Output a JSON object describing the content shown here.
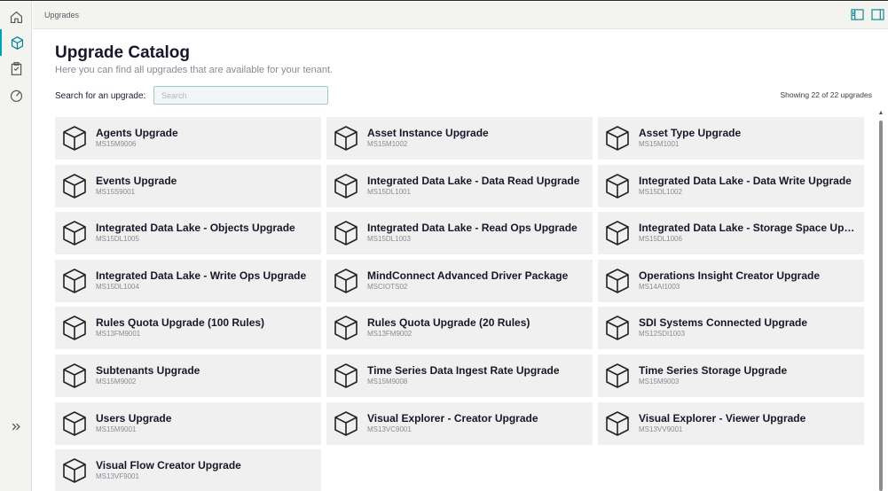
{
  "topbar": {
    "breadcrumb": "Upgrades"
  },
  "page": {
    "title": "Upgrade Catalog",
    "subtitle": "Here you can find all upgrades that are available for your tenant.",
    "search_label": "Search for an upgrade:",
    "search_placeholder": "Search",
    "search_value": "",
    "count_text": "Showing 22 of 22 upgrades"
  },
  "sidebar": {
    "items": [
      {
        "icon": "home-icon"
      },
      {
        "icon": "cube-icon",
        "active": true
      },
      {
        "icon": "clipboard-icon"
      },
      {
        "icon": "gauge-icon"
      }
    ],
    "expand_icon": "double-chevron-right-icon"
  },
  "upgrades": [
    {
      "name": "Agents Upgrade",
      "code": "MS15M9006"
    },
    {
      "name": "Asset Instance Upgrade",
      "code": "MS15M1002"
    },
    {
      "name": "Asset Type Upgrade",
      "code": "MS15M1001"
    },
    {
      "name": "Events Upgrade",
      "code": "MS15S9001"
    },
    {
      "name": "Integrated Data Lake - Data Read Upgrade",
      "code": "MS15DL1001"
    },
    {
      "name": "Integrated Data Lake - Data Write Upgrade",
      "code": "MS15DL1002"
    },
    {
      "name": "Integrated Data Lake - Objects Upgrade",
      "code": "MS15DL1005"
    },
    {
      "name": "Integrated Data Lake - Read Ops Upgrade",
      "code": "MS15DL1003"
    },
    {
      "name": "Integrated Data Lake - Storage Space Upgra...",
      "code": "MS15DL1006"
    },
    {
      "name": "Integrated Data Lake - Write Ops Upgrade",
      "code": "MS15DL1004"
    },
    {
      "name": "MindConnect Advanced Driver Package",
      "code": "MSCIOTS02"
    },
    {
      "name": "Operations Insight Creator Upgrade",
      "code": "MS14AI1003"
    },
    {
      "name": "Rules Quota Upgrade (100 Rules)",
      "code": "MS13FM9001"
    },
    {
      "name": "Rules Quota Upgrade (20 Rules)",
      "code": "MS13FM9002"
    },
    {
      "name": "SDI Systems Connected Upgrade",
      "code": "MS12SDI1003"
    },
    {
      "name": "Subtenants Upgrade",
      "code": "MS15M9002"
    },
    {
      "name": "Time Series Data Ingest Rate Upgrade",
      "code": "MS15M9008"
    },
    {
      "name": "Time Series Storage Upgrade",
      "code": "MS15M9003"
    },
    {
      "name": "Users Upgrade",
      "code": "MS15M9001"
    },
    {
      "name": "Visual Explorer - Creator Upgrade",
      "code": "MS13VC9001"
    },
    {
      "name": "Visual Explorer - Viewer Upgrade",
      "code": "MS13VV9001"
    },
    {
      "name": "Visual Flow Creator Upgrade",
      "code": "MS13VF9001"
    }
  ],
  "colors": {
    "accent": "#00a3b4",
    "card_bg": "#f0f0f0"
  }
}
